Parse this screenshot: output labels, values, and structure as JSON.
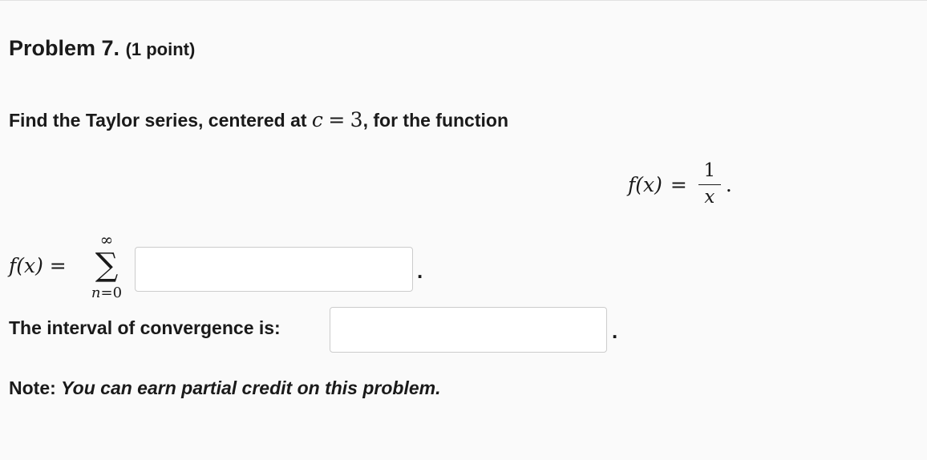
{
  "problem": {
    "title": "Problem 7.",
    "points": "(1 point)"
  },
  "prompt": {
    "text_before": "Find the Taylor series, centered at ",
    "variable": "c",
    "equals": "=",
    "value": "3",
    "text_after": ", for the function"
  },
  "function_display": {
    "lhs": "f(x)",
    "equals": "=",
    "numerator": "1",
    "denominator": "x",
    "trailing": "."
  },
  "series": {
    "lhs": "f(x) =",
    "upper_limit": "∞",
    "sigma": "∑",
    "lower_limit_var": "n",
    "lower_limit_eq": "=",
    "lower_limit_val": "0",
    "answer_value": "",
    "trailing": "."
  },
  "interval": {
    "label": "The interval of convergence is:",
    "answer_value": "",
    "trailing": "."
  },
  "note": {
    "label": "Note:",
    "text": "You can earn partial credit on this problem."
  }
}
